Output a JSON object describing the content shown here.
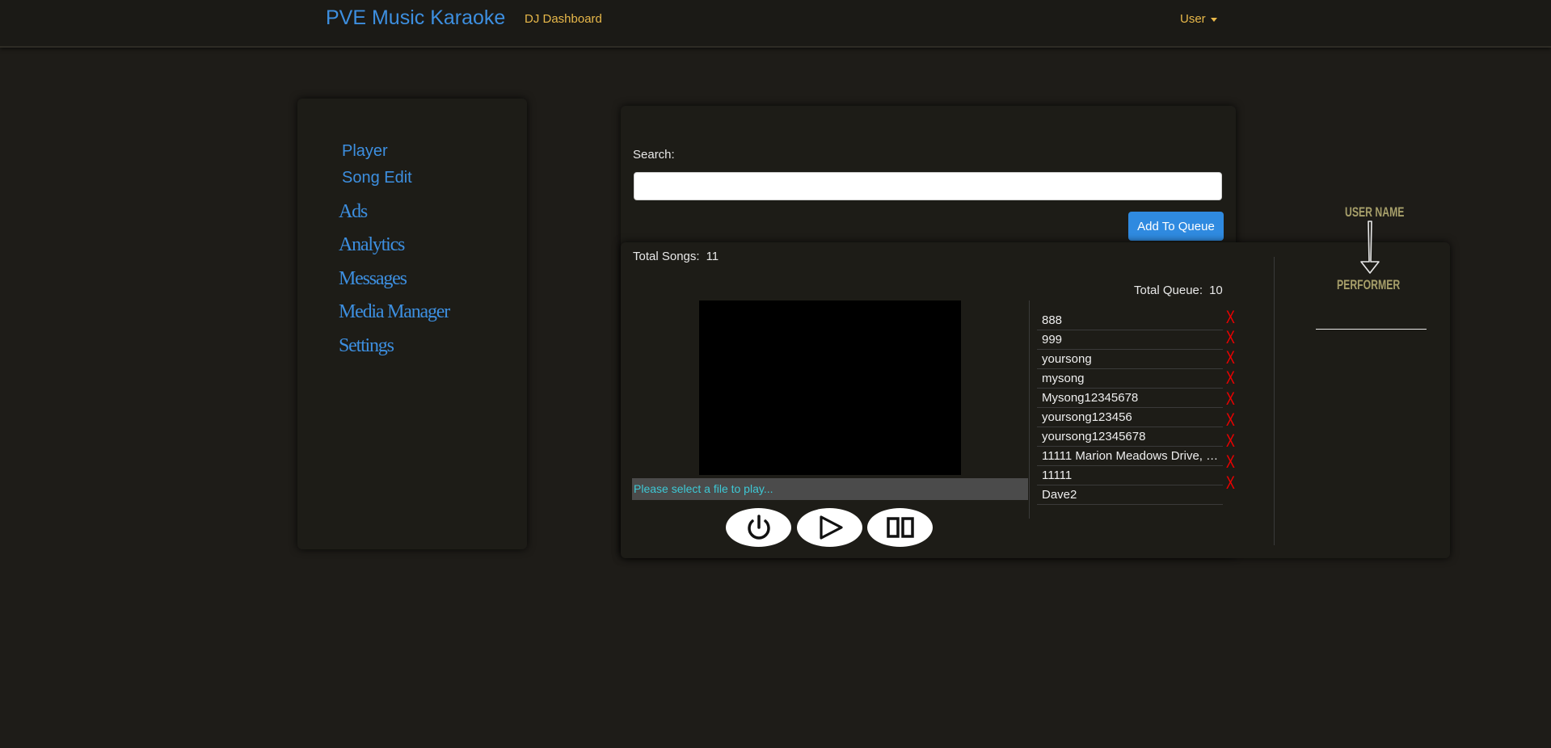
{
  "navbar": {
    "brand": "PVE Music Karaoke",
    "dashboard_link": "DJ Dashboard",
    "user_menu": "User"
  },
  "sidebar": {
    "items": [
      {
        "label": "Player"
      },
      {
        "label": "Song Edit"
      },
      {
        "label": "Ads"
      },
      {
        "label": "Analytics"
      },
      {
        "label": "Messages"
      },
      {
        "label": "Media Manager"
      },
      {
        "label": "Settings"
      }
    ]
  },
  "search": {
    "label": "Search:",
    "value": "",
    "add_button": "Add To Queue"
  },
  "player": {
    "total_songs_label": "Total Songs:",
    "total_songs_value": "11",
    "status_text": "Please select a file to play...",
    "controls": [
      "power-icon",
      "play-icon",
      "pause-icon"
    ]
  },
  "queue": {
    "total_label": "Total Queue:",
    "total_value": "10",
    "remove_label": "X",
    "items": [
      "888",
      "999",
      "yoursong",
      "mysong",
      "Mysong12345678",
      "yoursong123456",
      "yoursong12345678",
      "11111 Marion Meadows Drive, G...",
      "11111",
      "Dave2"
    ]
  },
  "performer": {
    "username_label": "USER NAME",
    "performer_label": "PERFORMER"
  },
  "colors": {
    "background": "#1e1c18",
    "accent_blue": "#3d8fe0",
    "nav_gold": "#e8b84a",
    "remove_red": "#e00000",
    "status_cyan": "#3ec9d6",
    "performer_olive": "#a79f6a"
  }
}
